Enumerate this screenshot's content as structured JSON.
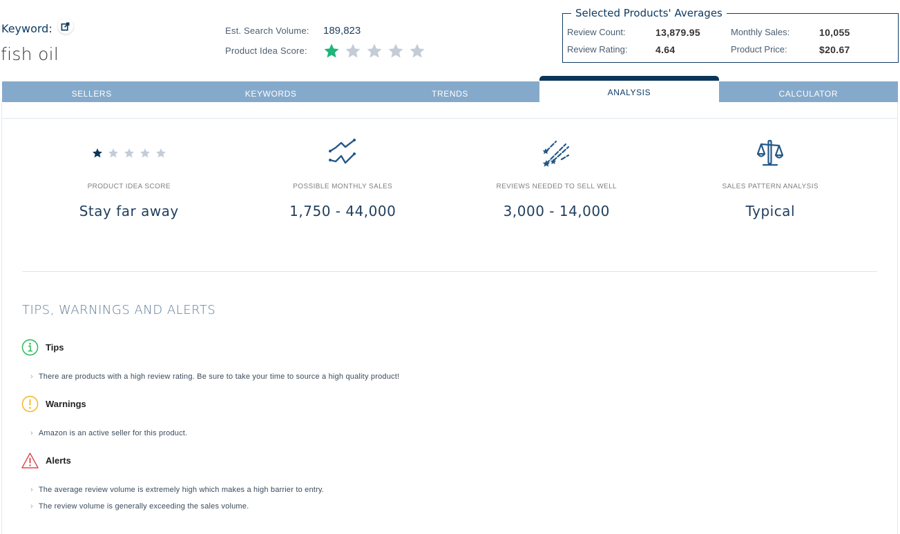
{
  "keyword": {
    "label": "Keyword:",
    "value": "fish oil",
    "external_link_icon": "external-link-icon"
  },
  "meta": {
    "search_volume_label": "Est. Search Volume:",
    "search_volume_value": "189,823",
    "idea_score_label": "Product Idea Score:",
    "idea_score_stars": 1,
    "idea_score_max": 5,
    "star_active_color": "#1db67a",
    "star_inactive_color": "#c3ccd7"
  },
  "averages": {
    "title": "Selected Products' Averages",
    "review_count_label": "Review Count:",
    "review_count_value": "13,879.95",
    "monthly_sales_label": "Monthly Sales:",
    "monthly_sales_value": "10,055",
    "review_rating_label": "Review Rating:",
    "review_rating_value": "4.64",
    "product_price_label": "Product Price:",
    "product_price_value": "$20.67"
  },
  "tabs": [
    {
      "label": "SELLERS",
      "active": false
    },
    {
      "label": "KEYWORDS",
      "active": false
    },
    {
      "label": "TRENDS",
      "active": false
    },
    {
      "label": "ANALYSIS",
      "active": true
    },
    {
      "label": "CALCULATOR",
      "active": false
    }
  ],
  "metrics": [
    {
      "icon": "star-rating-icon",
      "label": "PRODUCT IDEA SCORE",
      "value": "Stay far away",
      "stars": 1,
      "max_stars": 5
    },
    {
      "icon": "trend-lines-icon",
      "label": "POSSIBLE MONTHLY SALES",
      "value": "1,750 - 44,000"
    },
    {
      "icon": "shooting-stars-icon",
      "label": "REVIEWS NEEDED TO SELL WELL",
      "value": "3,000 - 14,000"
    },
    {
      "icon": "balance-scale-icon",
      "label": "SALES PATTERN ANALYSIS",
      "value": "Typical"
    }
  ],
  "tips_section": {
    "title": "TIPS, WARNINGS AND ALERTS",
    "tips": {
      "label": "Tips",
      "icon": "info-circle-icon",
      "color": "#2bbd5c",
      "items": [
        "There are products with a high review rating. Be sure to take your time to source a high quality product!"
      ]
    },
    "warnings": {
      "label": "Warnings",
      "icon": "exclamation-circle-icon",
      "color": "#f3b82b",
      "items": [
        "Amazon is an active seller for this product."
      ]
    },
    "alerts": {
      "label": "Alerts",
      "icon": "warning-triangle-icon",
      "color": "#e0373c",
      "items": [
        "The average review volume is extremely high which makes a high barrier to entry.",
        "The review volume is generally exceeding the sales volume."
      ]
    }
  }
}
